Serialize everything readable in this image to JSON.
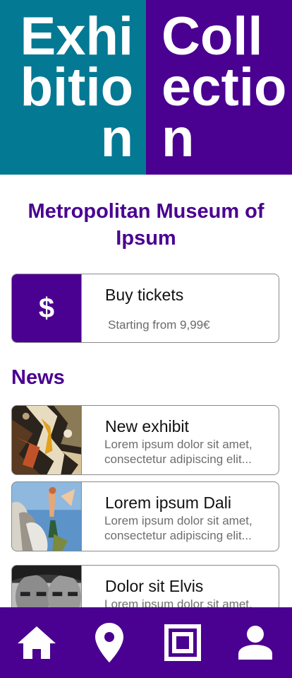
{
  "hero": {
    "left_text": "Exhibition",
    "right_text": "Collection",
    "left_color": "#047994",
    "right_color": "#4a0090"
  },
  "museum": {
    "name": "Metropolitan Museum of Ipsum"
  },
  "tickets": {
    "icon": "dollar-icon",
    "symbol": "$",
    "title": "Buy tickets",
    "subtitle": "Starting from 9,99€"
  },
  "news": {
    "heading": "News",
    "items": [
      {
        "title": "New exhibit",
        "line1": "Lorem ipsum dolor sit amet,",
        "line2": "consectetur adipiscing elit..."
      },
      {
        "title": "Lorem ipsum Dali",
        "line1": "Lorem ipsum dolor sit amet,",
        "line2": "consectetur adipiscing elit..."
      },
      {
        "title": "Dolor sit Elvis",
        "line1": "Lorem ipsum dolor sit amet,",
        "line2": ""
      }
    ]
  },
  "nav": {
    "items": [
      {
        "icon": "home-icon"
      },
      {
        "icon": "location-pin-icon"
      },
      {
        "icon": "gallery-frame-icon"
      },
      {
        "icon": "profile-icon"
      }
    ]
  },
  "colors": {
    "accent": "#4a0090",
    "teal": "#047994"
  }
}
